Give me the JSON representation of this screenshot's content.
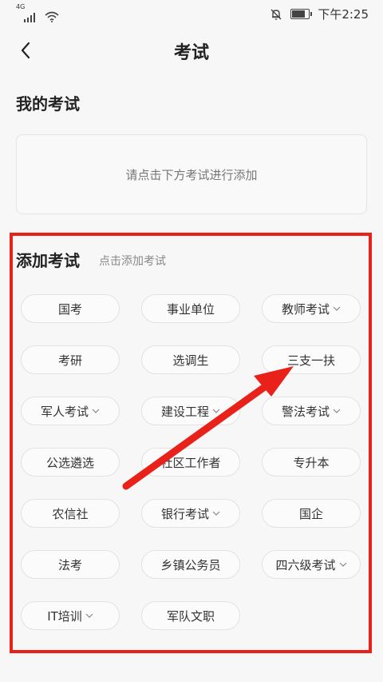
{
  "status_bar": {
    "network": "4G",
    "time": "下午2:25"
  },
  "header": {
    "title": "考试"
  },
  "my_exams": {
    "title": "我的考试",
    "empty_text": "请点击下方考试进行添加"
  },
  "add_exams": {
    "title": "添加考试",
    "hint": "点击添加考试",
    "chips": [
      {
        "label": "国考",
        "dropdown": false
      },
      {
        "label": "事业单位",
        "dropdown": false
      },
      {
        "label": "教师考试",
        "dropdown": true
      },
      {
        "label": "考研",
        "dropdown": false
      },
      {
        "label": "选调生",
        "dropdown": false
      },
      {
        "label": "三支一扶",
        "dropdown": false
      },
      {
        "label": "军人考试",
        "dropdown": true
      },
      {
        "label": "建设工程",
        "dropdown": true
      },
      {
        "label": "警法考试",
        "dropdown": true
      },
      {
        "label": "公选遴选",
        "dropdown": false
      },
      {
        "label": "社区工作者",
        "dropdown": false
      },
      {
        "label": "专升本",
        "dropdown": false
      },
      {
        "label": "农信社",
        "dropdown": false
      },
      {
        "label": "银行考试",
        "dropdown": true
      },
      {
        "label": "国企",
        "dropdown": false
      },
      {
        "label": "法考",
        "dropdown": false
      },
      {
        "label": "乡镇公务员",
        "dropdown": false
      },
      {
        "label": "四六级考试",
        "dropdown": true
      },
      {
        "label": "IT培训",
        "dropdown": true
      },
      {
        "label": "军队文职",
        "dropdown": false
      }
    ]
  },
  "colors": {
    "highlight": "#e8221b",
    "background": "#f7f7f7"
  }
}
